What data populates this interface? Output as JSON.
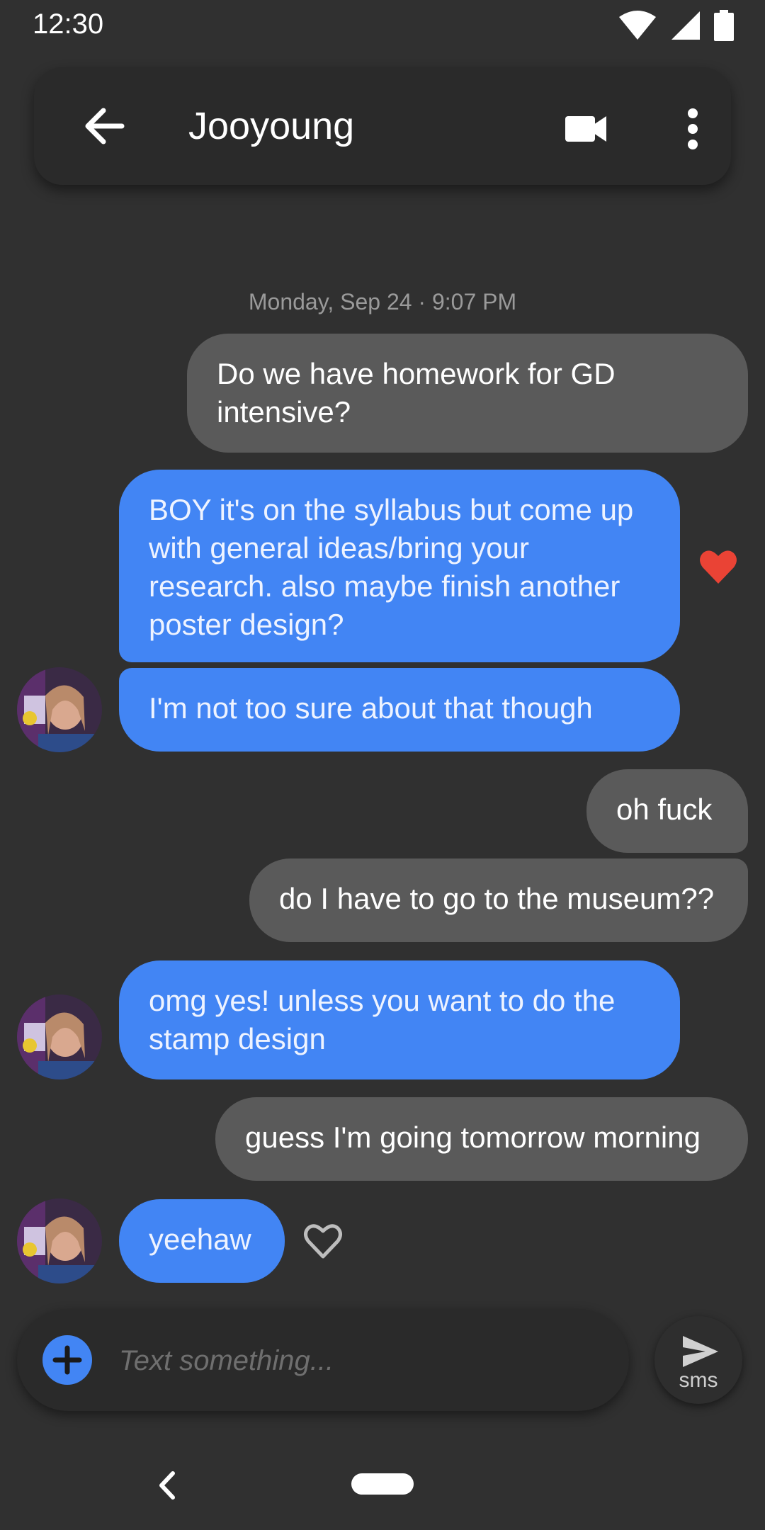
{
  "status_bar": {
    "time": "12:30"
  },
  "app_bar": {
    "contact_name": "Jooyoung"
  },
  "conversation": {
    "timestamp": "Monday, Sep 24 · 9:07 PM",
    "messages": [
      {
        "direction": "outgoing",
        "text": "Do we have homework for GD intensive?"
      },
      {
        "direction": "incoming",
        "text": "BOY it's on the syllabus but come up with general ideas/bring your research. also maybe finish another poster design?",
        "reaction": "heart-filled"
      },
      {
        "direction": "incoming",
        "text": "I'm not too sure about that though"
      },
      {
        "direction": "outgoing",
        "text": "oh fuck"
      },
      {
        "direction": "outgoing",
        "text": "do I have to go to the museum??"
      },
      {
        "direction": "incoming",
        "text": "omg yes! unless you want to do the stamp design"
      },
      {
        "direction": "outgoing",
        "text": "guess I'm going tomorrow morning"
      },
      {
        "direction": "incoming",
        "text": "yeehaw",
        "reaction": "heart-outline"
      }
    ]
  },
  "compose": {
    "placeholder": "Text something...",
    "value": ""
  },
  "send_button": {
    "label": "sms"
  },
  "colors": {
    "background": "#303030",
    "outgoing_bubble": "#5a5a5a",
    "incoming_bubble": "#4285f4",
    "reaction_heart": "#ea4335"
  }
}
